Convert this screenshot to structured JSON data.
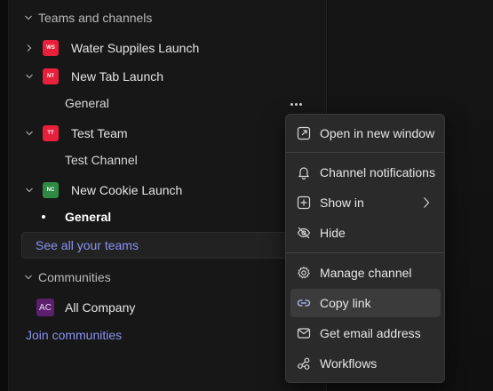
{
  "teams_section": {
    "label": "Teams and channels"
  },
  "teams": [
    {
      "name": "Water Suppiles Launch",
      "initials": "WS",
      "color": "#e8203c",
      "expanded": false
    },
    {
      "name": "New Tab Launch",
      "initials": "NT",
      "color": "#e8203c",
      "expanded": true,
      "channels": [
        "General"
      ]
    },
    {
      "name": "Test Team",
      "initials": "TT",
      "color": "#e8203c",
      "expanded": true,
      "channels": [
        "Test Channel"
      ]
    },
    {
      "name": "New Cookie Launch",
      "initials": "NC",
      "color": "#2f8a46",
      "expanded": true,
      "channels": [
        "General"
      ]
    }
  ],
  "see_all_teams": "See all your teams",
  "communities_section": {
    "label": "Communities"
  },
  "communities": [
    {
      "name": "All Company",
      "initials": "AC"
    }
  ],
  "join_communities": "Join communities",
  "context_menu": {
    "items": [
      {
        "label": "Open in new window",
        "icon": "open-external-icon"
      },
      {
        "label": "Channel notifications",
        "icon": "bell-icon"
      },
      {
        "label": "Show in",
        "icon": "plus-square-icon",
        "has_submenu": true
      },
      {
        "label": "Hide",
        "icon": "eye-off-icon"
      },
      {
        "label": "Manage channel",
        "icon": "gear-icon"
      },
      {
        "label": "Copy link",
        "icon": "link-icon",
        "highlighted": true
      },
      {
        "label": "Get email address",
        "icon": "mail-icon"
      },
      {
        "label": "Workflows",
        "icon": "workflow-icon"
      }
    ]
  },
  "colors": {
    "accent_link": "#8b92f2",
    "menu_bg": "#2a2a2a",
    "menu_hover": "#3b3b3b",
    "pane_bg": "#171717"
  }
}
